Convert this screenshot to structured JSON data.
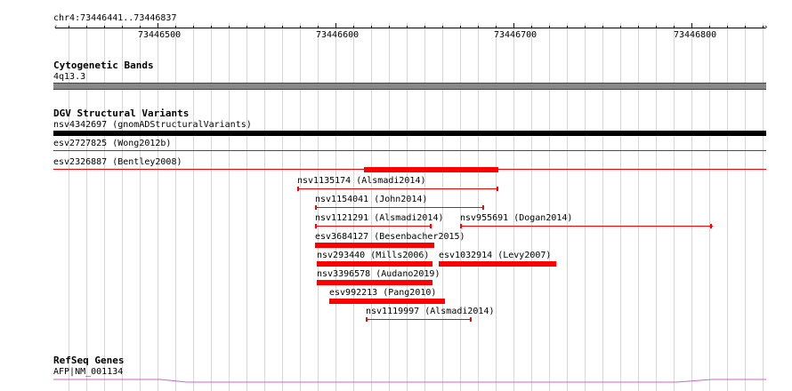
{
  "position_label": "chr4:73446441..73446837",
  "ruler": {
    "ticks": [
      "73446500",
      "73446600",
      "73446700",
      "73446800"
    ]
  },
  "colors": {
    "grid": "#c3dceb",
    "variant": "#ff0000",
    "band": "#888888",
    "gene": "#cc66cc"
  },
  "tracks": {
    "cytoband": {
      "title": "Cytogenetic Bands",
      "band_label": "4q13.3"
    },
    "dgv": {
      "title": "DGV Structural Variants",
      "rows": [
        {
          "label": "nsv4342697 (gnomADStructuralVariants)"
        },
        {
          "label": "esv2727825 (Wong2012b)"
        },
        {
          "label": "esv2326887 (Bentley2008)"
        }
      ],
      "features": [
        {
          "label": ""
        },
        {
          "label": "nsv1135174 (Alsmadi2014)"
        },
        {
          "label": "nsv1154041 (John2014)"
        },
        {
          "label": "nsv1121291 (Alsmadi2014)"
        },
        {
          "label": "nsv955691 (Dogan2014)"
        },
        {
          "label": "esv3684127 (Besenbacher2015)"
        },
        {
          "label": "nsv293440 (Mills2006)"
        },
        {
          "label": "esv1032914 (Levy2007)"
        },
        {
          "label": "nsv3396578 (Audano2019)"
        },
        {
          "label": "esv992213 (Pang2010)"
        },
        {
          "label": "nsv1119997 (Alsmadi2014)"
        }
      ]
    },
    "refseq": {
      "title": "RefSeq Genes",
      "gene_label": "AFP|NM_001134"
    }
  }
}
